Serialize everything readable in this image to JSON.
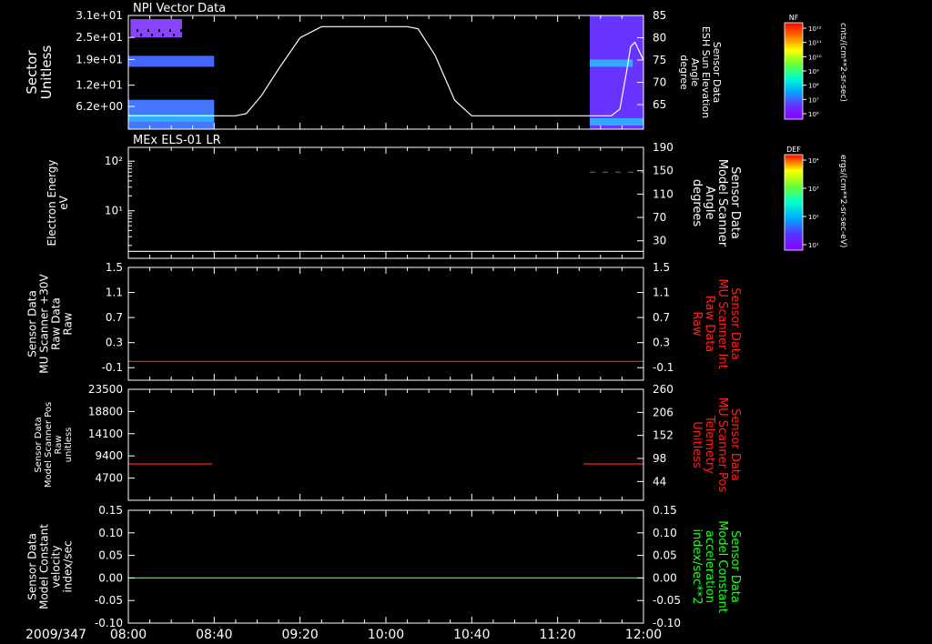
{
  "colors": {
    "background": "#000000",
    "axis": "#ffffff",
    "red": "#ff2020",
    "green": "#20ff20",
    "spec": "#6633ff"
  },
  "xaxis": {
    "date_label": "2009/347",
    "tick_labels": [
      "08:00",
      "08:40",
      "09:20",
      "10:00",
      "10:40",
      "11:20",
      "12:00"
    ],
    "start_minutes": 480,
    "end_minutes": 720
  },
  "panels": [
    {
      "title": "NPI Vector Data"
    },
    {
      "title": "MEx ELS-01 LR"
    }
  ],
  "colorbars": [
    {
      "tag": "NF",
      "unit": "cnts/(cm**2-sr-sec)",
      "tick_labels": [
        "10¹²",
        "10¹¹",
        "10¹⁰",
        "10⁹",
        "10⁸",
        "10⁷",
        "10⁶"
      ]
    },
    {
      "tag": "DEF",
      "unit": "ergs/(cm**2-sr-sec-eV)",
      "tick_labels": [
        "10⁴",
        "10³",
        "10²",
        "10¹"
      ]
    }
  ],
  "chart_data": [
    {
      "type": "heatmap",
      "title": "NPI Vector Data",
      "ylabel": [
        "Sector",
        "Unitless"
      ],
      "y_tick_labels": [
        "3.1e+01",
        "2.5e+01",
        "1.9e+01",
        "1.2e+01",
        "6.2e+00"
      ],
      "y_ticks": [
        31,
        25,
        19,
        12,
        6.2
      ],
      "ylim": [
        0,
        31
      ],
      "spectrogram_blocks": [
        {
          "t0": 480,
          "t1": 520,
          "y0": 0,
          "y1": 8,
          "color": "#4477ff"
        },
        {
          "t0": 480,
          "t1": 520,
          "y0": 2,
          "y1": 4,
          "color": "#33aaff"
        },
        {
          "t0": 480,
          "t1": 520,
          "y0": 17,
          "y1": 20,
          "color": "#4466ff"
        },
        {
          "t0": 481,
          "t1": 505,
          "y0": 25,
          "y1": 30,
          "color": "#8844ff"
        },
        {
          "t0": 695,
          "t1": 720,
          "y0": 0,
          "y1": 31,
          "color": "#6633ff"
        },
        {
          "t0": 695,
          "t1": 715,
          "y0": 17,
          "y1": 19,
          "color": "#33aaff"
        },
        {
          "t0": 695,
          "t1": 720,
          "y0": 1,
          "y1": 3,
          "color": "#33aaff"
        }
      ],
      "right_axis": {
        "label": [
          "Sensor Data",
          "ESH Sun Elevation",
          "Angle",
          "degree"
        ],
        "tick_labels": [
          "85",
          "80",
          "75",
          "70",
          "65"
        ],
        "ticks": [
          85,
          80,
          75,
          70,
          65
        ],
        "ylim": [
          59.5,
          85
        ]
      },
      "series": [
        {
          "axis": "right",
          "color": "#ffffff",
          "x": [
            480,
            530,
            535,
            542,
            550,
            560,
            570,
            575,
            590,
            600,
            610,
            615,
            623,
            632,
            640,
            695,
            705,
            709,
            712,
            714,
            716,
            718,
            720
          ],
          "y": [
            62.5,
            62.5,
            63,
            67,
            73,
            80,
            82.5,
            82.5,
            82.5,
            82.5,
            82.5,
            82,
            76,
            66,
            62.5,
            62.5,
            62.5,
            64,
            72,
            78,
            79,
            77,
            75
          ]
        }
      ]
    },
    {
      "type": "line",
      "title": "MEx ELS-01 LR",
      "ylabel": [
        "Electron Energy",
        "eV"
      ],
      "y_tick_labels": [
        "10²",
        "10¹"
      ],
      "y_ticks": [
        100,
        10
      ],
      "ylog": true,
      "ylim": [
        1.1,
        190
      ],
      "right_axis": {
        "label": [
          "Sensor Data",
          "Model Scanner",
          "Angle",
          "degrees"
        ],
        "tick_labels": [
          "190",
          "150",
          "110",
          "70",
          "30"
        ],
        "ticks": [
          190,
          150,
          110,
          70,
          30
        ],
        "ylim": [
          0,
          190
        ]
      },
      "series": [
        {
          "axis": "right",
          "color": "#ffffff",
          "x": [
            480,
            720
          ],
          "y": [
            12,
            12
          ]
        },
        {
          "axis": "left",
          "color": "#4455ff",
          "dashed": true,
          "x": [
            695,
            720
          ],
          "y": [
            60,
            60
          ]
        }
      ]
    },
    {
      "type": "line",
      "ylabel": [
        "Sensor Data",
        "MU Scanner +30V",
        "Raw Data",
        "Raw"
      ],
      "y_tick_labels": [
        "1.5",
        "1.1",
        "0.7",
        "0.3",
        "-0.1"
      ],
      "y_ticks": [
        1.5,
        1.1,
        0.7,
        0.3,
        -0.1
      ],
      "ylim": [
        -0.3,
        1.5
      ],
      "right_axis": {
        "label": [
          "Sensor Data",
          "MU Scanner Int",
          "Raw Data",
          "Raw"
        ],
        "tick_labels": [
          "1.5",
          "1.1",
          "0.7",
          "0.3",
          "-0.1"
        ],
        "ticks": [
          1.5,
          1.1,
          0.7,
          0.3,
          -0.1
        ],
        "ylim": [
          -0.3,
          1.5
        ]
      },
      "series": [
        {
          "axis": "left",
          "color": "#ff2020",
          "x": [
            480,
            720
          ],
          "y": [
            0,
            0
          ]
        }
      ]
    },
    {
      "type": "line",
      "ylabel": [
        "Sensor Data",
        "Model Scanner Pos",
        "Raw",
        "unitless"
      ],
      "y_tick_labels": [
        "23500",
        "18800",
        "14100",
        "9400",
        "4700"
      ],
      "y_ticks": [
        23500,
        18800,
        14100,
        9400,
        4700
      ],
      "ylim": [
        0,
        23500
      ],
      "right_axis": {
        "label": [
          "Sensor Data",
          "MU Scanner Pos",
          "Telemetry",
          "Unitless"
        ],
        "tick_labels": [
          "260",
          "206",
          "152",
          "98",
          "44"
        ],
        "ticks": [
          260,
          206,
          152,
          98,
          44
        ],
        "ylim": [
          0,
          260
        ]
      },
      "series": [
        {
          "axis": "left",
          "color": "#ff2020",
          "x": [
            480,
            519
          ],
          "y": [
            7700,
            7700
          ]
        },
        {
          "axis": "left",
          "color": "#ff2020",
          "x": [
            692,
            720
          ],
          "y": [
            7700,
            7700
          ]
        }
      ]
    },
    {
      "type": "line",
      "ylabel": [
        "Sensor Data",
        "Model Constant",
        "velocity",
        "index/sec"
      ],
      "y_tick_labels": [
        "0.15",
        "0.10",
        "0.05",
        "0.00",
        "-0.05",
        "-0.10"
      ],
      "y_ticks": [
        0.15,
        0.1,
        0.05,
        0.0,
        -0.05,
        -0.1
      ],
      "ylim": [
        -0.1,
        0.15
      ],
      "right_axis": {
        "label": [
          "Sensor Data",
          "Model Constant",
          "acceleration",
          "index/sec**2"
        ],
        "tick_labels": [
          "0.15",
          "0.10",
          "0.05",
          "0.00",
          "-0.05",
          "-0.10"
        ],
        "ticks": [
          0.15,
          0.1,
          0.05,
          0.0,
          -0.05,
          -0.1
        ],
        "ylim": [
          -0.1,
          0.15
        ]
      },
      "series": [
        {
          "axis": "left",
          "color": "#20ff20",
          "x": [
            480,
            720
          ],
          "y": [
            0,
            0
          ]
        }
      ]
    }
  ]
}
